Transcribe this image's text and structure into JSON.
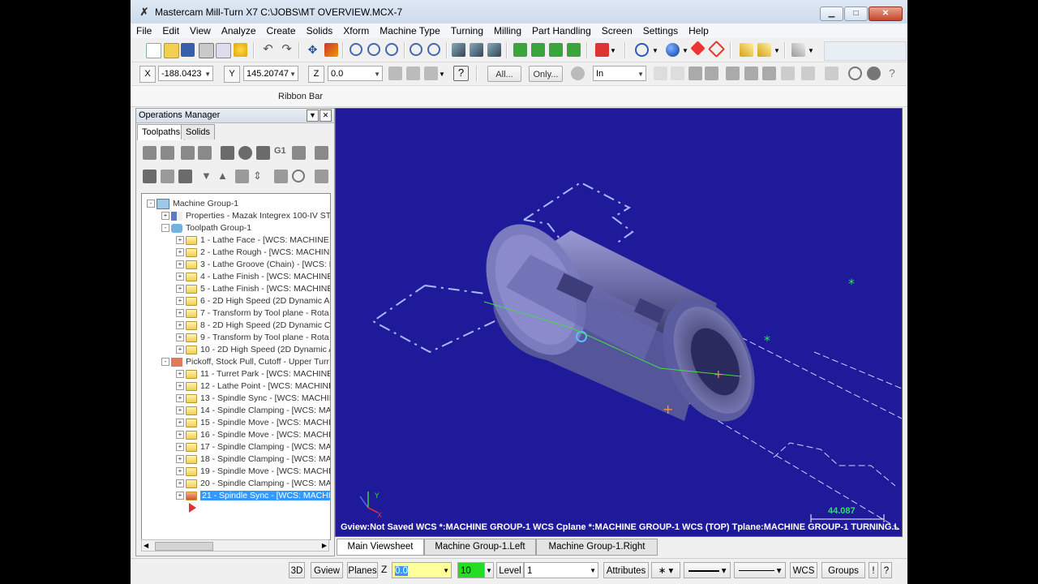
{
  "window": {
    "title": "Mastercam Mill-Turn X7  C:\\JOBS\\MT OVERVIEW.MCX-7",
    "minimize": "▁",
    "maximize": "□",
    "close": "✕"
  },
  "menu": [
    "File",
    "Edit",
    "View",
    "Analyze",
    "Create",
    "Solids",
    "Xform",
    "Machine Type",
    "Turning",
    "Milling",
    "Part Handling",
    "Screen",
    "Settings",
    "Help"
  ],
  "coords": {
    "x_label": "X",
    "x_value": "-188.0423",
    "y_label": "Y",
    "y_value": "145.20747",
    "z_label": "Z",
    "z_value": "0.0"
  },
  "ribbon_buttons": {
    "all": "All...",
    "only": "Only...",
    "units": "In"
  },
  "ribbon_bar_label": "Ribbon Bar",
  "ops_manager": {
    "title": "Operations Manager",
    "tabs": [
      "Toolpaths",
      "Solids"
    ],
    "tree": [
      {
        "label": "Machine Group-1",
        "indent": 0,
        "icon": "machine-group",
        "sign": "-"
      },
      {
        "label": "Properties - Mazak Integrex 100-IV ST",
        "indent": 1,
        "icon": "properties",
        "sign": "+"
      },
      {
        "label": "Toolpath Group-1",
        "indent": 1,
        "icon": "toolpath-group",
        "sign": "-"
      },
      {
        "label": "1 - Lathe Face - [WCS: MACHINE G",
        "indent": 2,
        "icon": "folder",
        "sign": "+"
      },
      {
        "label": "2 - Lathe Rough - [WCS: MACHINE",
        "indent": 2,
        "icon": "folder",
        "sign": "+"
      },
      {
        "label": "3 - Lathe Groove (Chain) - [WCS: M",
        "indent": 2,
        "icon": "folder",
        "sign": "+"
      },
      {
        "label": "4 - Lathe Finish - [WCS: MACHINE",
        "indent": 2,
        "icon": "folder",
        "sign": "+"
      },
      {
        "label": "5 - Lathe Finish - [WCS: MACHINE",
        "indent": 2,
        "icon": "folder",
        "sign": "+"
      },
      {
        "label": "6 - 2D High Speed (2D Dynamic Are",
        "indent": 2,
        "icon": "folder",
        "sign": "+"
      },
      {
        "label": "7 - Transform by Tool plane - Rota",
        "indent": 2,
        "icon": "folder",
        "sign": "+"
      },
      {
        "label": "8 - 2D High Speed (2D Dynamic Cor",
        "indent": 2,
        "icon": "folder",
        "sign": "+"
      },
      {
        "label": "9 - Transform by Tool plane - Rota",
        "indent": 2,
        "icon": "folder",
        "sign": "+"
      },
      {
        "label": "10 - 2D High Speed (2D Dynamic A",
        "indent": 2,
        "icon": "folder",
        "sign": "+"
      },
      {
        "label": "Pickoff, Stock Pull, Cutoff - Upper Turr",
        "indent": 1,
        "icon": "group-red",
        "sign": "-"
      },
      {
        "label": "11 - Turret Park - [WCS: MACHINE",
        "indent": 2,
        "icon": "folder",
        "sign": "+"
      },
      {
        "label": "12 - Lathe Point - [WCS: MACHINE",
        "indent": 2,
        "icon": "folder",
        "sign": "+"
      },
      {
        "label": "13 - Spindle Sync - [WCS: MACHIN",
        "indent": 2,
        "icon": "folder",
        "sign": "+"
      },
      {
        "label": "14 - Spindle Clamping - [WCS: MAC",
        "indent": 2,
        "icon": "folder",
        "sign": "+"
      },
      {
        "label": "15 - Spindle Move - [WCS: MACHIN",
        "indent": 2,
        "icon": "folder",
        "sign": "+"
      },
      {
        "label": "16 - Spindle Move - [WCS: MACHIN",
        "indent": 2,
        "icon": "folder",
        "sign": "+"
      },
      {
        "label": "17 - Spindle Clamping - [WCS: MAC",
        "indent": 2,
        "icon": "folder",
        "sign": "+"
      },
      {
        "label": "18 - Spindle Clamping - [WCS: MAC",
        "indent": 2,
        "icon": "folder",
        "sign": "+"
      },
      {
        "label": "19 - Spindle Move - [WCS: MACHIN",
        "indent": 2,
        "icon": "folder",
        "sign": "+"
      },
      {
        "label": "20 - Spindle Clamping - [WCS: MAC",
        "indent": 2,
        "icon": "folder",
        "sign": "+"
      },
      {
        "label": "21 - Spindle Sync - [WCS: MACHIN",
        "indent": 2,
        "icon": "folder-x",
        "sign": "+",
        "selected": true
      }
    ]
  },
  "viewport": {
    "status_line": "Gview:Not Saved   WCS *:MACHINE GROUP-1 WCS   Cplane *:MACHINE GROUP-1 WCS (TOP)   Tplane:MACHINE GROUP-1 TURNING.L",
    "scale_value": "44.087",
    "background": "#1f1a99"
  },
  "sheet_tabs": [
    "Main Viewsheet",
    "Machine Group-1.Left",
    "Machine Group-1.Right"
  ],
  "bottom_bar": {
    "mode_3d": "3D",
    "gview": "Gview",
    "planes": "Planes",
    "z_label": "Z",
    "z_value": "0.0",
    "color_value": "10",
    "level_label": "Level",
    "level_value": "1",
    "attributes": "Attributes",
    "wcs": "WCS",
    "groups": "Groups",
    "help_q": "?",
    "help_excl": "!"
  }
}
